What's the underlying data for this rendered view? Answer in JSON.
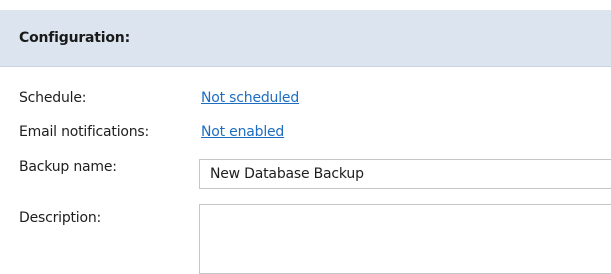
{
  "configuration": {
    "title": "Configuration:",
    "schedule": {
      "label": "Schedule:",
      "value": "Not scheduled"
    },
    "email_notifications": {
      "label": "Email notifications:",
      "value": "Not enabled"
    },
    "backup_name": {
      "label": "Backup name:",
      "value": "New Database Backup"
    },
    "description": {
      "label": "Description:",
      "value": ""
    }
  }
}
